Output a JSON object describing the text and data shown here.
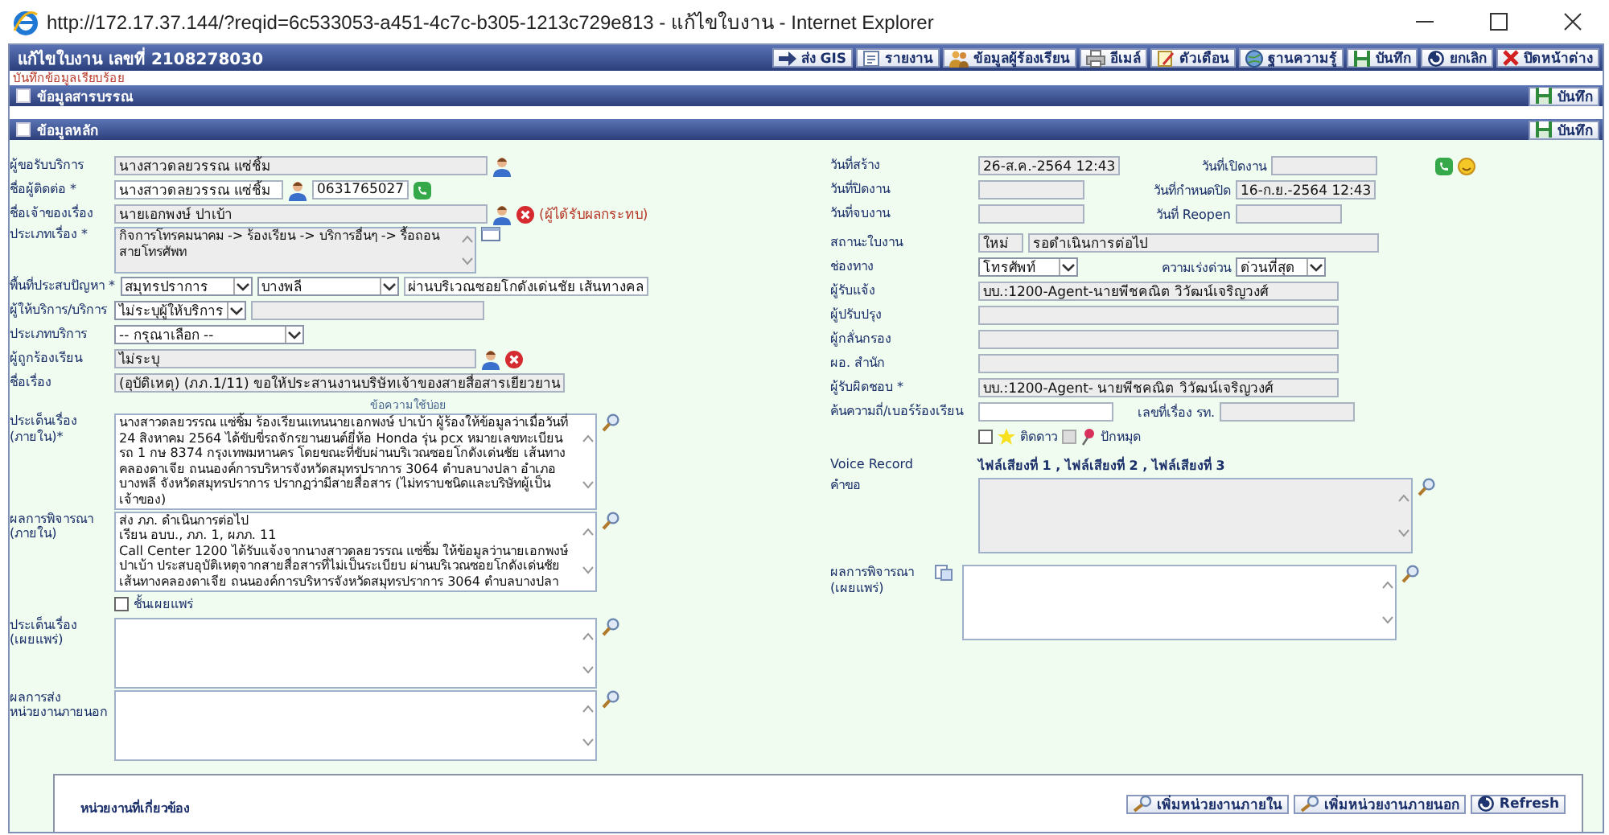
{
  "window": {
    "title": "http://172.17.37.144/?reqid=6c533053-a451-4c7c-b305-1213c729e813 - แก้ไขใบงาน - Internet Explorer"
  },
  "header": {
    "title": "แก้ไขใบงาน เลขที่ 2108278030",
    "buttons": [
      {
        "kind": "send",
        "label": "ส่ง GIS"
      },
      {
        "kind": "report",
        "label": "รายงาน"
      },
      {
        "kind": "people",
        "label": "ข้อมูลผู้ร้องเรียน"
      },
      {
        "kind": "email",
        "label": "อีเมล์"
      },
      {
        "kind": "reminder",
        "label": "ตัวเตือน"
      },
      {
        "kind": "knowledge",
        "label": "ฐานความรู้"
      },
      {
        "kind": "save",
        "label": "บันทึก"
      },
      {
        "kind": "cancel",
        "label": "ยกเลิก"
      },
      {
        "kind": "close",
        "label": "ปิดหน้าต่าง"
      }
    ]
  },
  "message": "บันทึกข้อมูลเรียบร้อย",
  "sections": [
    {
      "title": "ข้อมูลสารบรรณ",
      "button": "บันทึก"
    },
    {
      "title": "ข้อมูลหลัก",
      "button": "บันทึก"
    }
  ],
  "left": {
    "requester": {
      "label": "ผู้ขอรับบริการ",
      "value": "นางสาวดลยวรรณ แซ่ชิ้ม",
      "readonly": true
    },
    "contact": {
      "label": "ชื่อผู้ติดต่อ *",
      "value": "นางสาวดลยวรรณ แซ่ชิ้ม",
      "phone": "0631765027",
      "readonly": false
    },
    "owner": {
      "label": "ชื่อเจ้าของเรื่อง",
      "value": "นายเอกพงษ์ ปาเบ้า",
      "note": "(ผู้ได้รับผลกระทบ)",
      "readonly": true
    },
    "subject_type": {
      "label": "ประเภทเรื่อง *",
      "value": "กิจการโทรคมนาคม -> ร้องเรียน -> บริการอื่นๆ -> รื้อถอนสายโทรศัพท",
      "readonly": true
    },
    "area": {
      "label": "พื้นที่ประสบปัญหา *",
      "province": "สมุทรปราการ",
      "district": "บางพลี",
      "detail": "ผ่านบริเวณซอยโกดังเด่นชัย เส้นทางคล",
      "readonly": false
    },
    "provider": {
      "label": "ผู้ให้บริการ/บริการ",
      "value": "ไม่ระบุผู้ให้บริการ",
      "readonly": true
    },
    "service_type": {
      "label": "ประเภทบริการ",
      "value": "-- กรุณาเลือก --"
    },
    "respondent": {
      "label": "ผู้ถูกร้องเรียน",
      "value": "ไม่ระบุ",
      "readonly": true
    },
    "title": {
      "label": "ชื่อเรื่อง",
      "value": "(อุบัติเหตุ) (ภภ.1/11) ขอให้ประสานงานบริษัทเจ้าของสายสื่อสารเยียวยาน",
      "readonly": true
    },
    "frequent_text_link": "ข้อความใช้บ่อย",
    "issue_internal": {
      "label": "ประเด็นเรื่อง\n(ภายใน)*",
      "value": "นางสาวดลยวรรณ แซ่ชิ้ม ร้องเรียนแทนนายเอกพงษ์ ปาเบ้า ผู้ร้องให้ข้อมูลว่าเมื่อวันที่ 24 สิงหาคม 2564 ได้ขับขี่รถจักรยานยนต์ยี่ห้อ Honda รุ่น pcx หมายเลขทะเบียนรถ 1 กษ 8374 กรุงเทพมหานคร โดยขณะที่ขับผ่านบริเวณซอยโกดังเด่นชัย เส้นทางคลองดาเจีย ถนนองค์การบริหารจังหวัดสมุทรปราการ 3064 ตำบลบางปลา อำเภอบางพลี จังหวัดสมุทรปราการ ปรากฏว่ามีสายสื่อสาร (ไม่ทราบชนิดและบริษัทผู้เป็นเจ้าของ)",
      "readonly": false
    },
    "result_internal": {
      "label": "ผลการพิจารณา\n(ภายใน)",
      "value": "ส่ง ภภ. ดำเนินการต่อไป\nเรียน อบบ., ภภ. 1, ผภภ. 11\nCall Center 1200 ได้รับแจ้งจากนางสาวดลยวรรณ แซ่ชิ้ม ให้ข้อมูลว่านายเอกพงษ์ ปาเบ้า  ประสบอุบัติเหตุจากสายสื่อสารที่ไม่เป็นระเบียบ ผ่านบริเวณซอยโกดังเด่นชัย เส้นทางคลองดาเจีย ถนนองค์การบริหารจังหวัดสมุทรปราการ 3064 ตำบลบางปลา",
      "readonly": false
    },
    "publish": {
      "label": "ชั้นเผยแพร่",
      "checked": false
    },
    "issue_public": {
      "label": "ประเด็นเรื่อง\n(เผยแพร่)",
      "readonly": false
    },
    "external_result": {
      "label": "ผลการส่ง\nหน่วยงานภายนอก",
      "readonly": false
    }
  },
  "right": {
    "created": {
      "label": "วันที่สร้าง",
      "value": "26-ส.ค.-2564 12:43",
      "readonly": true
    },
    "opened": {
      "label": "วันที่เปิดงาน",
      "readonly": true
    },
    "closed": {
      "label": "วันที่ปิดงาน",
      "readonly": true
    },
    "due": {
      "label": "วันที่กำหนดปิด",
      "value": "16-ก.ย.-2564 12:43",
      "readonly": true
    },
    "ended": {
      "label": "วันที่จบงาน",
      "readonly": true
    },
    "reopen": {
      "label": "วันที่ Reopen",
      "readonly": true
    },
    "status": {
      "label": "สถานะใบงาน",
      "code": "ใหม่",
      "value": "รอดำเนินการต่อไป",
      "readonly": true
    },
    "channel": {
      "label": "ช่องทาง",
      "value": "โทรศัพท์"
    },
    "urgency": {
      "label": "ความเร่งด่วน",
      "value": "ด่วนที่สุด"
    },
    "notifier": {
      "label": "ผู้รับแจ้ง",
      "value": "บบ.:1200-Agent-นายพีชคณิต  วิวัฒน์เจริญวงศ์",
      "readonly": true
    },
    "improver": {
      "label": "ผู้ปรับปรุง",
      "readonly": true
    },
    "screener": {
      "label": "ผู้กลั่นกรอง",
      "readonly": true
    },
    "director": {
      "label": "ผอ. สำนัก",
      "readonly": true
    },
    "responsible": {
      "label": "ผู้รับผิดชอบ *",
      "value": "บบ.:1200-Agent- นายพีชคณิต  วิวัฒน์เจริญวงศ์",
      "readonly": true
    },
    "search": {
      "label": "ค้นความถี่/เบอร์ร้องเรียน",
      "readonly": false
    },
    "case_no": {
      "label": "เลขที่เรื่อง รท.",
      "readonly": true
    },
    "star": {
      "label": "ติดดาว",
      "checked": false
    },
    "pin": {
      "label": "ปักหมุด",
      "checked": false,
      "disabled": true
    },
    "voice": {
      "label": "Voice Record",
      "separator": ",",
      "files": [
        "ไฟล์เสียงที่ 1",
        "ไฟล์เสียงที่ 2",
        "ไฟล์เสียงที่ 3"
      ]
    },
    "request": {
      "label": "คำขอ",
      "readonly": true
    },
    "result_public": {
      "label": "ผลการพิจารณา\n(เผยแพร่)",
      "readonly": false
    }
  },
  "related": {
    "title": "หน่วยงานที่เกี่ยวข้อง",
    "buttons": [
      {
        "kind": "search",
        "label": "เพิ่มหน่วยงานภายใน"
      },
      {
        "kind": "search",
        "label": "เพิ่มหน่วยงานภายนอก"
      },
      {
        "kind": "refresh",
        "label": "Refresh"
      }
    ]
  }
}
